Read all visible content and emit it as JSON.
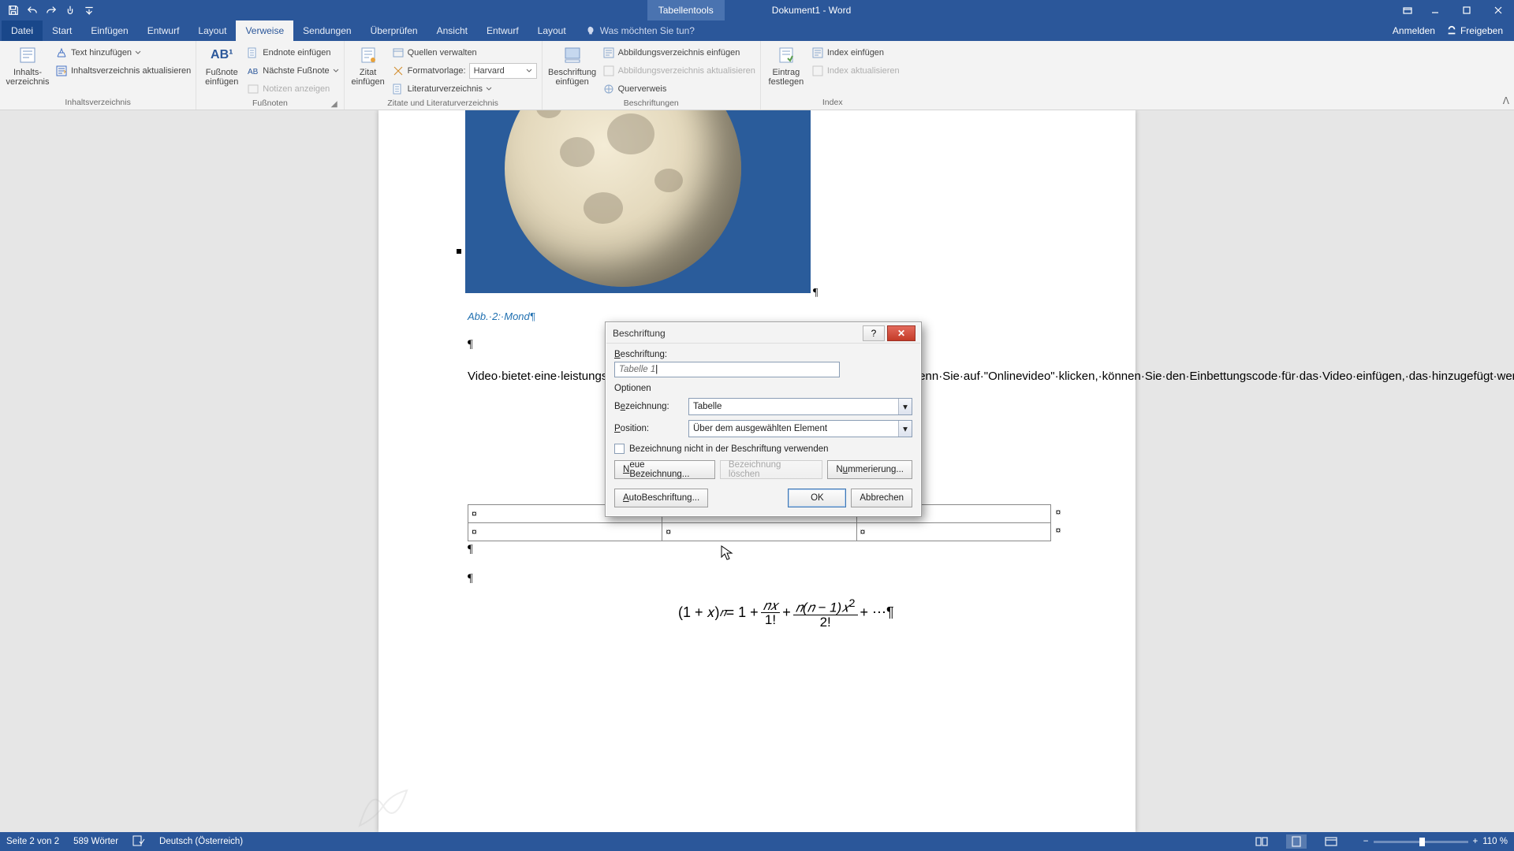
{
  "titlebar": {
    "contextTab": "Tabellentools",
    "docTitle": "Dokument1 - Word"
  },
  "tabs": {
    "file": "Datei",
    "start": "Start",
    "insert": "Einfügen",
    "draft": "Entwurf",
    "layout1": "Layout",
    "references": "Verweise",
    "mailings": "Sendungen",
    "review": "Überprüfen",
    "view": "Ansicht",
    "design": "Entwurf",
    "layout2": "Layout",
    "tell": "Was möchten Sie tun?",
    "signin": "Anmelden",
    "share": "Freigeben"
  },
  "ribbon": {
    "g1": {
      "big": "Inhalts-\nverzeichnis",
      "addText": "Text hinzufügen",
      "update": "Inhaltsverzeichnis aktualisieren",
      "label": "Inhaltsverzeichnis"
    },
    "g2": {
      "big": "Fußnote\neinfügen",
      "ab": "AB¹",
      "endnote": "Endnote einfügen",
      "next": "Nächste Fußnote",
      "show": "Notizen anzeigen",
      "label": "Fußnoten"
    },
    "g3": {
      "big": "Zitat\neinfügen",
      "manage": "Quellen verwalten",
      "styleLbl": "Formatvorlage:",
      "styleVal": "Harvard",
      "biblio": "Literaturverzeichnis",
      "label": "Zitate und Literaturverzeichnis"
    },
    "g4": {
      "big": "Beschriftung\neinfügen",
      "insFig": "Abbildungsverzeichnis einfügen",
      "updFig": "Abbildungsverzeichnis aktualisieren",
      "xref": "Querverweis",
      "label": "Beschriftungen"
    },
    "g5": {
      "big": "Eintrag\nfestlegen",
      "insIdx": "Index einfügen",
      "updIdx": "Index aktualisieren",
      "label": "Index"
    }
  },
  "doc": {
    "caption": "Abb.·2:·Mond¶",
    "pmark": "¶",
    "body": "Video·bietet·eine·leistungsstarke·Möglichkeit·zur·Unterstützung·Ihres·Standpunkts.·Wenn·Sie·auf·\"Onlinevideo\"·klicken,·können·Sie·den·Einbettungscode·für·das·Video·einfügen,·das·hinzugefügt·werden·soll.·Sie·können·auch·ein·Stichwort·eingeben,·um·online·nach·dem·Videoclip·zu·suchen,·der·optimal·zu·Ihrem·Dokument·passt.Damit·Ihr·Dokument·ein·professionelles·Aussehen·erhält,·stellt·Word·einander·ergänzende·Designs·für·Kopfzeile,·Fußzeile,·Deckblatt·und·Textfelder·zur·Verfügung.·Beispielsweise·können·Sie·ein·passendes·Deckblatt·mit·Kopfzeile·und·Randleiste·hinzufügen.·Klicken·Sie·auf·\"Einfügen\",·und·wählen·Sie·dann·die·gewünschten·Elemente·aus·den·verschiedenen.¶",
    "cell": "¤",
    "eq1": "(1 + 𝑥)",
    "eqn": "𝑛",
    "eq2": " = 1 + ",
    "nx": "𝑛𝑥",
    "one": "1!",
    "eq3": " + ",
    "nn1": "𝑛(𝑛 − 1)𝑥",
    "sq": "2",
    "two": "2!",
    "eq4": " + ⋯¶"
  },
  "dialog": {
    "title": "Beschriftung",
    "lbl": "Beschriftung:",
    "val": "Tabelle 1",
    "options": "Optionen",
    "bez": "Bezeichnung:",
    "bezVal": "Tabelle",
    "pos": "Position:",
    "posVal": "Über dem ausgewählten Element",
    "chk": "Bezeichnung nicht in der Beschriftung verwenden",
    "newLabel": "Neue Bezeichnung...",
    "delLabel": "Bezeichnung löschen",
    "numbering": "Nummerierung...",
    "auto": "AutoBeschriftung...",
    "ok": "OK",
    "cancel": "Abbrechen"
  },
  "status": {
    "page": "Seite 2 von 2",
    "words": "589 Wörter",
    "lang": "Deutsch (Österreich)",
    "zoom": "110 %"
  }
}
